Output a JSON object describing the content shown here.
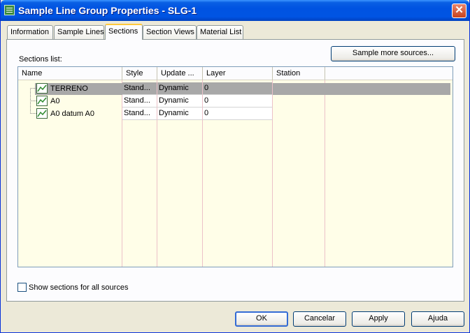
{
  "window": {
    "title": "Sample Line Group Properties - SLG-1",
    "icon": "civil-app-icon",
    "close_label": "✕"
  },
  "tabs": [
    {
      "label": "Information",
      "active": false
    },
    {
      "label": "Sample Lines",
      "active": false
    },
    {
      "label": "Sections",
      "active": true
    },
    {
      "label": "Section Views",
      "active": false
    },
    {
      "label": "Material List",
      "active": false
    }
  ],
  "sections": {
    "sample_more_button": "Sample more sources...",
    "list_label": "Sections list:",
    "columns": [
      "Name",
      "Style",
      "Update ...",
      "Layer",
      "Station"
    ],
    "rows": [
      {
        "name": "TERRENO",
        "style": "Stand...",
        "update": "Dynamic",
        "layer": "0",
        "station": "",
        "selected": true
      },
      {
        "name": "A0",
        "style": "Stand...",
        "update": "Dynamic",
        "layer": "0",
        "station": "",
        "selected": false
      },
      {
        "name": "A0 datum A0",
        "style": "Stand...",
        "update": "Dynamic",
        "layer": "0",
        "station": "",
        "selected": false
      }
    ],
    "show_all_label": "Show sections for all sources",
    "show_all_checked": false
  },
  "footer": {
    "ok": "OK",
    "cancel": "Cancelar",
    "apply": "Apply",
    "help": "Ajuda"
  },
  "colors": {
    "title_bar": "#0054e3",
    "list_background": "#fffee8",
    "selection": "#a8a8a8"
  }
}
